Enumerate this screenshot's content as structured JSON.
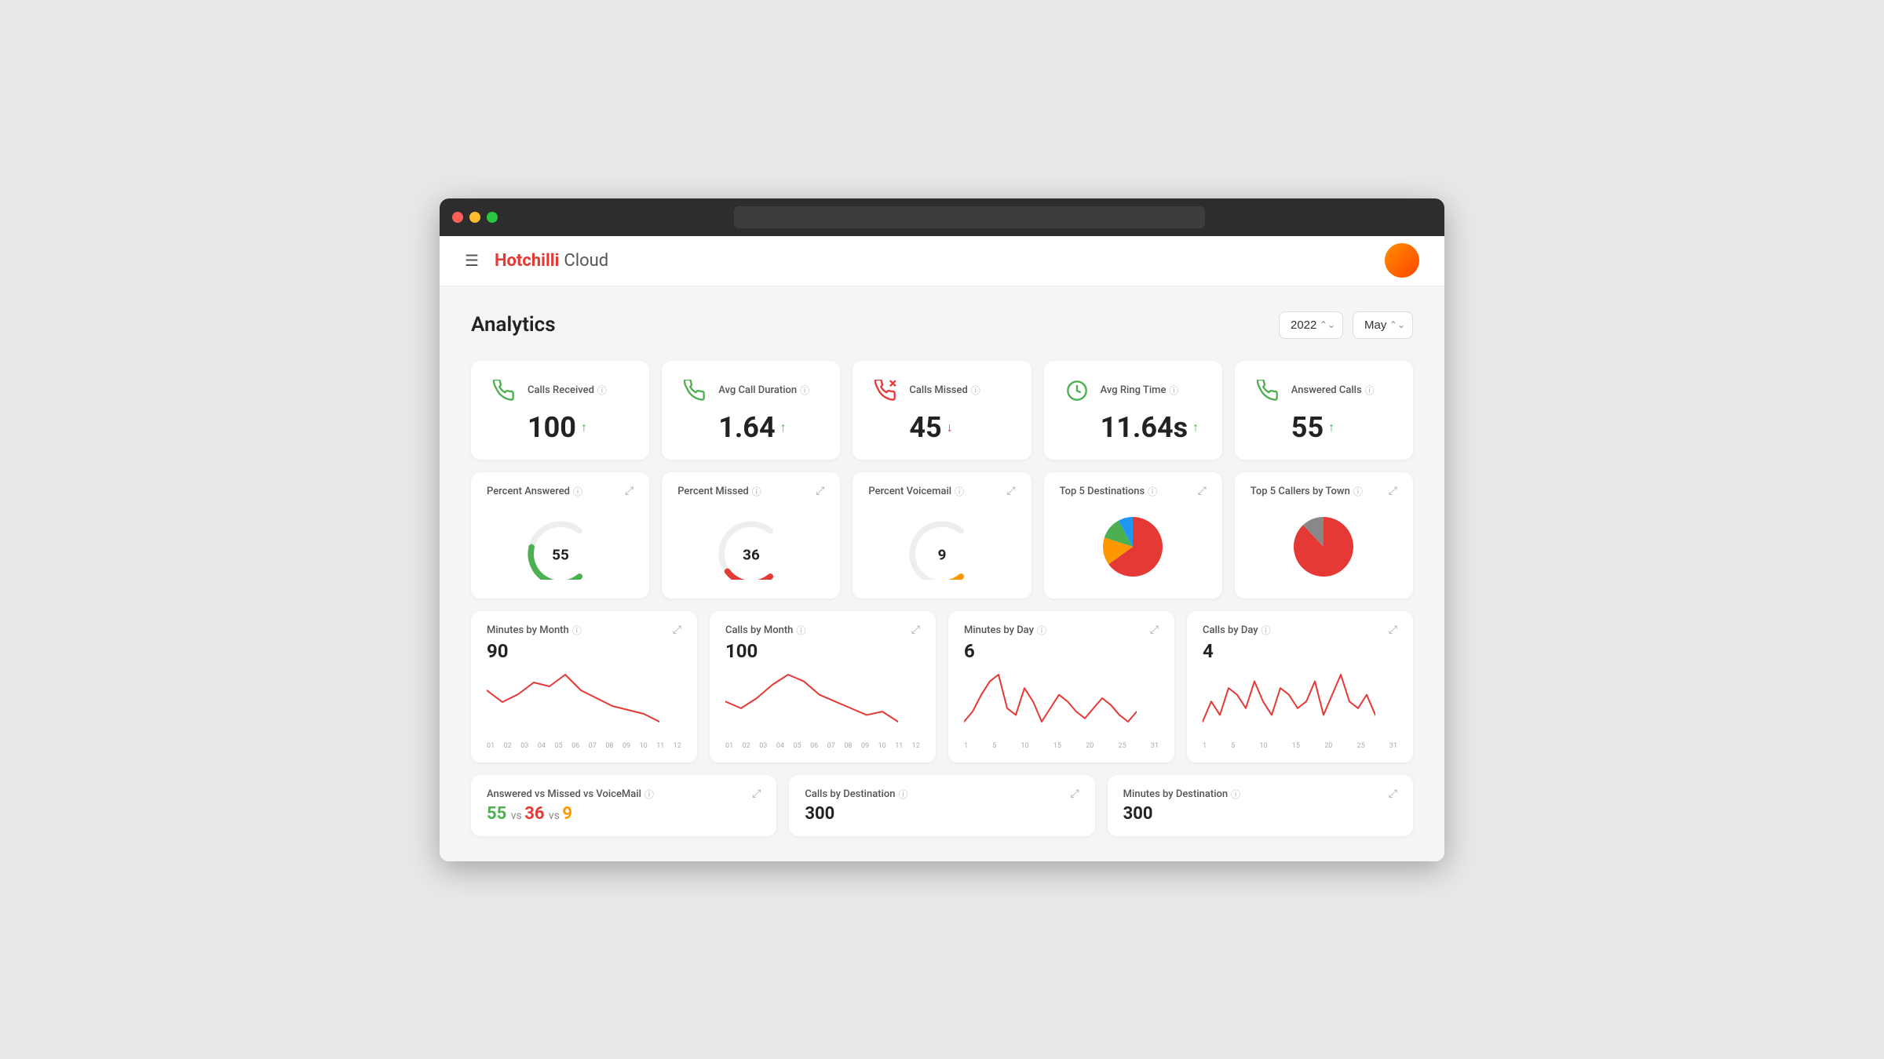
{
  "browser": {
    "url": ""
  },
  "nav": {
    "logo_hot": "Hotchilli",
    "logo_cloud": "Cloud",
    "hamburger": "☰"
  },
  "page": {
    "title": "Analytics",
    "year": "2022",
    "month": "May"
  },
  "stats": [
    {
      "id": "calls-received",
      "label": "Calls Received",
      "value": "100",
      "trend": "up",
      "icon": "📞",
      "icon_color": "#4caf50"
    },
    {
      "id": "avg-call-duration",
      "label": "Avg Call Duration",
      "value": "1.64",
      "trend": "up",
      "icon": "📞",
      "icon_color": "#4caf50"
    },
    {
      "id": "calls-missed",
      "label": "Calls Missed",
      "value": "45",
      "trend": "down",
      "icon": "📞",
      "icon_color": "#e53935"
    },
    {
      "id": "avg-ring-time",
      "label": "Avg Ring Time",
      "value": "11.64s",
      "trend": "up",
      "icon": "🕐",
      "icon_color": "#4caf50"
    },
    {
      "id": "answered-calls",
      "label": "Answered Calls",
      "value": "55",
      "trend": "up",
      "icon": "📞",
      "icon_color": "#4caf50"
    }
  ],
  "widgets": [
    {
      "id": "percent-answered",
      "label": "Percent Answered",
      "value": 55,
      "color": "#4caf50"
    },
    {
      "id": "percent-missed",
      "label": "Percent Missed",
      "value": 36,
      "color": "#e53935"
    },
    {
      "id": "percent-voicemail",
      "label": "Percent Voicemail",
      "value": 9,
      "color": "#ff9800"
    },
    {
      "id": "top5-destinations",
      "label": "Top 5 Destinations",
      "pie": true,
      "colors": [
        "#e53935",
        "#ff9800",
        "#4caf50",
        "#2196f3"
      ]
    },
    {
      "id": "top5-callers",
      "label": "Top 5 Callers by Town",
      "pie": true,
      "colors": [
        "#e53935",
        "#888"
      ]
    }
  ],
  "charts": [
    {
      "id": "minutes-by-month",
      "label": "Minutes by Month",
      "value": "90",
      "labels": [
        "01",
        "02",
        "03",
        "04",
        "05",
        "06",
        "07",
        "08",
        "09",
        "10",
        "11",
        "12"
      ],
      "points": [
        60,
        45,
        55,
        70,
        65,
        80,
        60,
        50,
        40,
        35,
        30,
        20
      ]
    },
    {
      "id": "calls-by-month",
      "label": "Calls by Month",
      "value": "100",
      "labels": [
        "01",
        "02",
        "03",
        "04",
        "05",
        "06",
        "07",
        "08",
        "09",
        "10",
        "11",
        "12"
      ],
      "points": [
        50,
        40,
        55,
        75,
        90,
        80,
        60,
        50,
        40,
        30,
        35,
        20
      ]
    },
    {
      "id": "minutes-by-day",
      "label": "Minutes by Day",
      "value": "6",
      "labels": [
        "1",
        "5",
        "10",
        "15",
        "20",
        "25",
        "31"
      ],
      "points": [
        20,
        35,
        60,
        80,
        90,
        40,
        30,
        70,
        50,
        20,
        40,
        60,
        50,
        35,
        25,
        40,
        55,
        45,
        30,
        20,
        35
      ]
    },
    {
      "id": "calls-by-day",
      "label": "Calls by Day",
      "value": "4",
      "labels": [
        "1",
        "5",
        "10",
        "15",
        "20",
        "25",
        "31"
      ],
      "points": [
        25,
        40,
        30,
        50,
        45,
        35,
        55,
        40,
        30,
        50,
        45,
        35,
        40,
        55,
        30,
        45,
        60,
        40,
        35,
        45,
        30
      ]
    }
  ],
  "bottom": [
    {
      "id": "answered-vs-missed",
      "label": "Answered vs Missed vs VoiceMail",
      "value": "55 vs 36 vs 9",
      "val_a": "55",
      "val_b": "36",
      "val_c": "9"
    },
    {
      "id": "calls-by-destination",
      "label": "Calls by Destination",
      "value": "300"
    },
    {
      "id": "minutes-by-destination",
      "label": "Minutes by Destination",
      "value": "300"
    }
  ],
  "labels": {
    "info": "ⓘ",
    "expand": "⤢",
    "up_arrow": "↑",
    "down_arrow": "↓"
  }
}
